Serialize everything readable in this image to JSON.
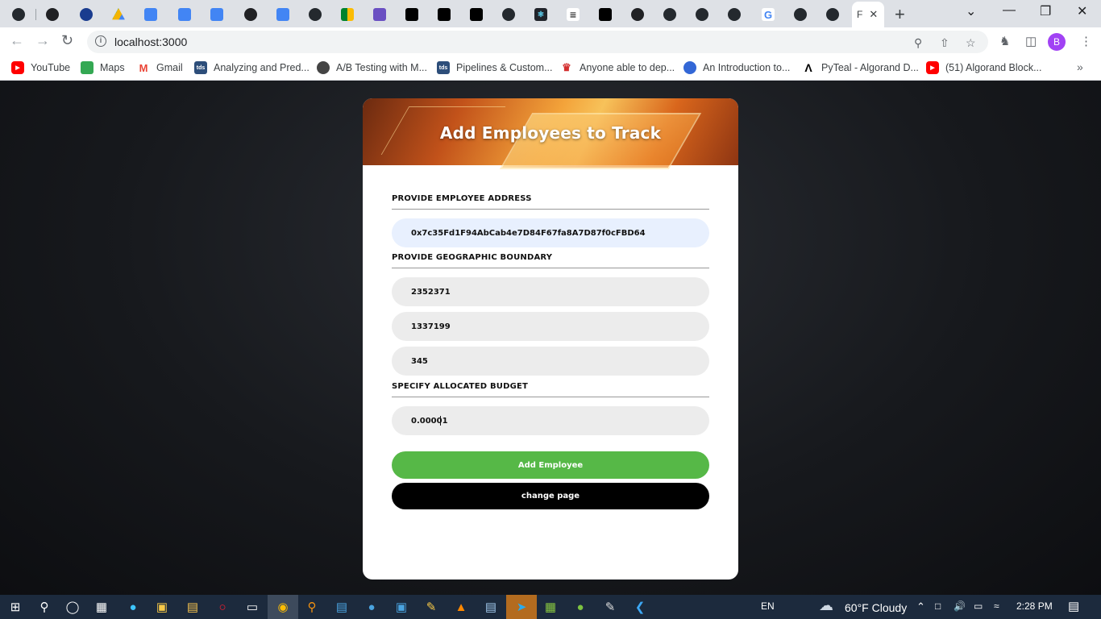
{
  "browser": {
    "active_tab_label": "F",
    "new_tab_symbol": "+",
    "url": "localhost:3000",
    "profile_initial": "B",
    "bookmarks": [
      {
        "label": "YouTube",
        "color": "#ff0000"
      },
      {
        "label": "Maps",
        "color": "#34a853"
      },
      {
        "label": "Gmail",
        "color": "#ea4335"
      },
      {
        "label": "Analyzing and Pred...",
        "color": "#2d4e7a",
        "icon_text": "tds"
      },
      {
        "label": "A/B Testing with M...",
        "color": "#444444"
      },
      {
        "label": "Pipelines & Custom...",
        "color": "#2d4e7a",
        "icon_text": "tds"
      },
      {
        "label": "Anyone able to dep...",
        "color": "#d32f2f"
      },
      {
        "label": "An Introduction to...",
        "color": "#3367d6"
      },
      {
        "label": "PyTeal - Algorand D...",
        "color": "#000000"
      },
      {
        "label": "(51) Algorand Block...",
        "color": "#ff0000"
      }
    ]
  },
  "form": {
    "title": "Add Employees to Track",
    "address_label": "PROVIDE EMPLOYEE ADDRESS",
    "address_value": "0x7c35Fd1F94AbCab4e7D84F67fa8A7D87f0cFBD64",
    "boundary_label": "PROVIDE GEOGRAPHIC BOUNDARY",
    "boundary_values": [
      "2352371",
      "1337199",
      "345"
    ],
    "budget_label": "SPECIFY ALLOCATED BUDGET",
    "budget_value": "0.00001",
    "add_button": "Add Employee",
    "change_button": "change page"
  },
  "taskbar": {
    "language": "EN",
    "weather": "60°F  Cloudy",
    "time": "2:28 PM"
  }
}
